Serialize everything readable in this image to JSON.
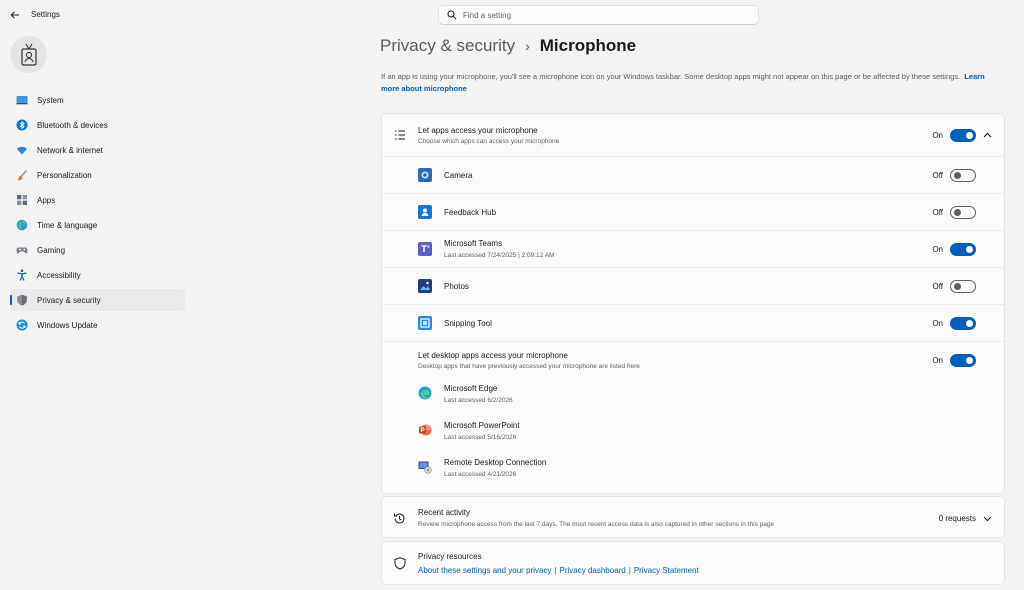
{
  "window": {
    "title": "Settings"
  },
  "search": {
    "placeholder": "Find a setting"
  },
  "sidebar": {
    "items": [
      {
        "label": "System",
        "icon": "system-icon"
      },
      {
        "label": "Bluetooth & devices",
        "icon": "bluetooth-icon"
      },
      {
        "label": "Network & internet",
        "icon": "wifi-icon"
      },
      {
        "label": "Personalization",
        "icon": "brush-icon"
      },
      {
        "label": "Apps",
        "icon": "apps-icon"
      },
      {
        "label": "Time & language",
        "icon": "globe-icon"
      },
      {
        "label": "Gaming",
        "icon": "gamepad-icon"
      },
      {
        "label": "Accessibility",
        "icon": "accessibility-icon"
      },
      {
        "label": "Privacy & security",
        "icon": "shield-icon",
        "active": true
      },
      {
        "label": "Windows Update",
        "icon": "update-icon"
      }
    ]
  },
  "breadcrumb": {
    "parent": "Privacy & security",
    "current": "Microphone"
  },
  "description": {
    "text": "If an app is using your microphone, you'll see a microphone icon on your Windows taskbar. Some desktop apps might not appear on this page or be affected by these settings.",
    "link": "Learn more about microphone"
  },
  "app_access": {
    "title": "Let apps access your microphone",
    "subtitle": "Choose which apps can access your microphone",
    "state": "On",
    "enabled": true
  },
  "apps": [
    {
      "name": "Camera",
      "state": "Off",
      "enabled": false,
      "icon": "camera-app-icon",
      "last_accessed": ""
    },
    {
      "name": "Feedback Hub",
      "state": "Off",
      "enabled": false,
      "icon": "feedback-hub-icon",
      "last_accessed": ""
    },
    {
      "name": "Microsoft Teams",
      "state": "On",
      "enabled": true,
      "icon": "teams-icon",
      "last_accessed": "Last accessed 7/24/2025  |  2:09:12 AM"
    },
    {
      "name": "Photos",
      "state": "Off",
      "enabled": false,
      "icon": "photos-icon",
      "last_accessed": ""
    },
    {
      "name": "Snipping Tool",
      "state": "On",
      "enabled": true,
      "icon": "snipping-tool-icon",
      "last_accessed": ""
    }
  ],
  "desktop_access": {
    "title": "Let desktop apps access your microphone",
    "subtitle": "Desktop apps that have previously accessed your microphone are listed here",
    "state": "On",
    "enabled": true,
    "apps": [
      {
        "name": "Microsoft Edge",
        "last_accessed": "Last accessed 6/2/2026",
        "icon": "edge-icon"
      },
      {
        "name": "Microsoft PowerPoint",
        "last_accessed": "Last accessed 5/16/2026",
        "icon": "powerpoint-icon"
      },
      {
        "name": "Remote Desktop Connection",
        "last_accessed": "Last accessed 4/21/2026",
        "icon": "remote-desktop-icon"
      }
    ]
  },
  "recent_activity": {
    "title": "Recent activity",
    "subtitle": "Review microphone access from the last 7 days. The most recent access data is also captured in other sections in this page",
    "count": "0 requests"
  },
  "privacy_resources": {
    "title": "Privacy resources",
    "links": [
      "About these settings and your privacy",
      "Privacy dashboard",
      "Privacy Statement"
    ],
    "separator": "|"
  },
  "colors": {
    "accent": "#005fb8",
    "background": "#f3f3f3",
    "card": "#fbfbfb"
  }
}
